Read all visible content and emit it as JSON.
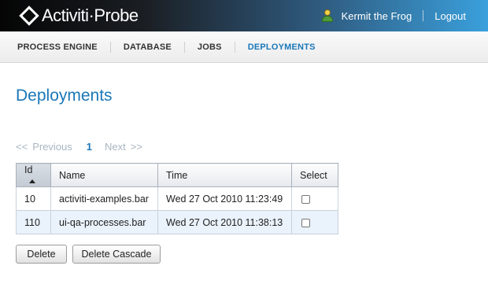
{
  "header": {
    "app_name": "Activiti·Probe",
    "user_name": "Kermit the Frog",
    "logout_label": "Logout"
  },
  "nav": {
    "items": [
      {
        "label": "PROCESS ENGINE"
      },
      {
        "label": "DATABASE"
      },
      {
        "label": "JOBS"
      },
      {
        "label": "DEPLOYMENTS"
      }
    ],
    "active": "DEPLOYMENTS"
  },
  "page": {
    "title": "Deployments"
  },
  "pager": {
    "first": "<<",
    "previous": "Previous",
    "current": "1",
    "next": "Next",
    "last": ">>"
  },
  "table": {
    "columns": [
      "Id",
      "Name",
      "Time",
      "Select"
    ],
    "sorted_column": "Id",
    "rows": [
      {
        "id": "10",
        "name": "activiti-examples.bar",
        "time": "Wed 27 Oct 2010 11:23:49",
        "selected": false
      },
      {
        "id": "110",
        "name": "ui-qa-processes.bar",
        "time": "Wed 27 Oct 2010 11:38:13",
        "selected": false
      }
    ]
  },
  "actions": {
    "delete_label": "Delete",
    "delete_cascade_label": "Delete Cascade"
  },
  "colors": {
    "accent": "#1a77b8",
    "row_alt": "#eaf2fb"
  }
}
